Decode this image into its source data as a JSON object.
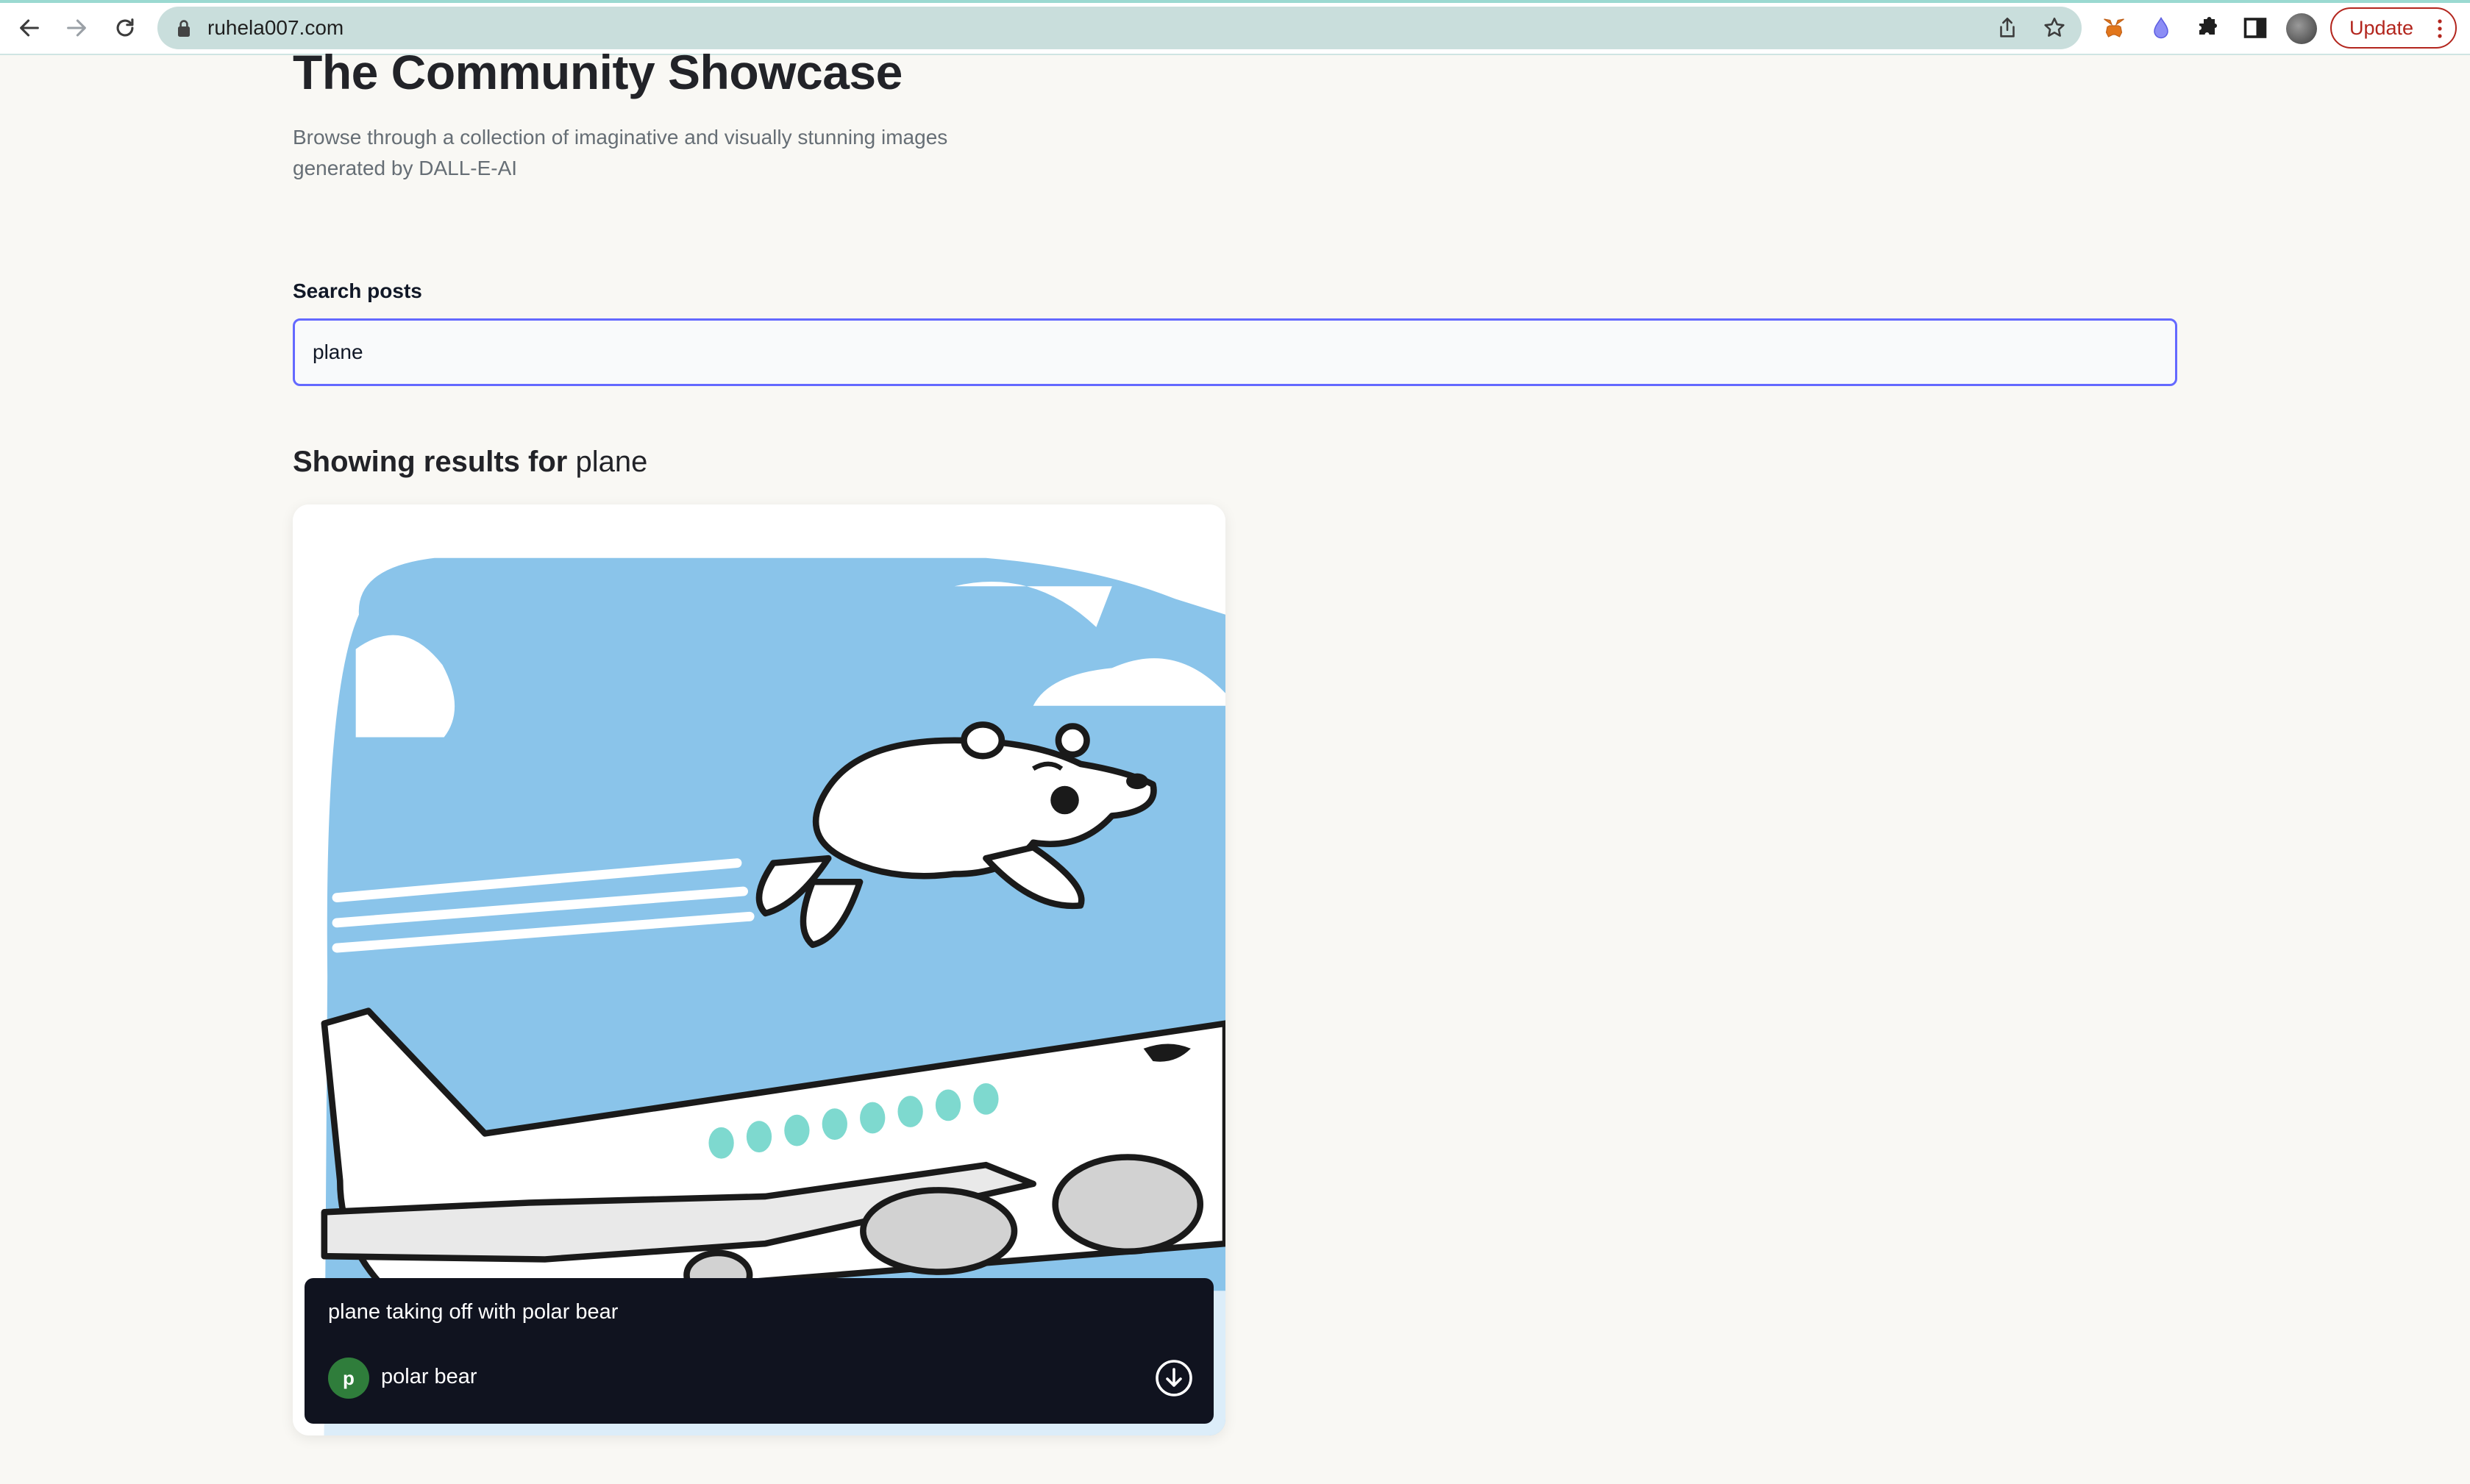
{
  "browser": {
    "url": "ruhela007.com",
    "update_label": "Update",
    "icons": [
      "back-icon",
      "forward-icon",
      "reload-icon",
      "lock-icon",
      "share-icon",
      "star-icon",
      "metamask-icon",
      "drop-icon",
      "puzzle-icon",
      "sidepanel-icon",
      "profile-icon",
      "more-vert-icon"
    ]
  },
  "header": {
    "title": "The Community Showcase",
    "subtitle": "Browse through a collection of imaginative and visually stunning images generated by DALL-E-AI"
  },
  "search": {
    "label": "Search posts",
    "value": "plane"
  },
  "results": {
    "prefix": "Showing results for ",
    "term": "plane"
  },
  "posts": [
    {
      "prompt": "plane taking off with polar bear",
      "author": "polar bear",
      "author_initial": "p",
      "image": "image-of-airplane-with-polar-bear-flying"
    }
  ],
  "colors": {
    "background": "#f9f8f4",
    "accent": "#6469ff",
    "overlay": "#10131f",
    "author_avatar": "#2f7d3b",
    "update": "#b3261e"
  }
}
